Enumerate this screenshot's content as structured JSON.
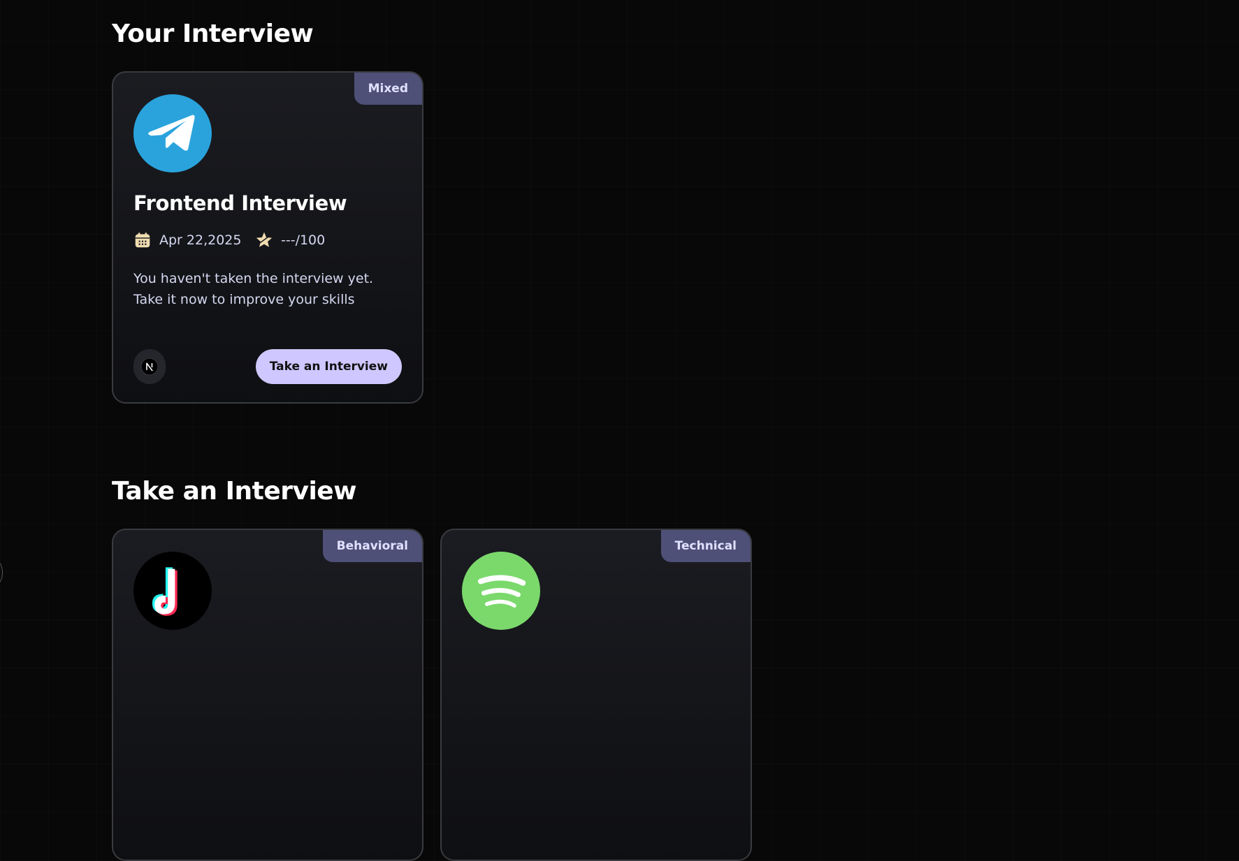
{
  "sections": {
    "your_interview_title": "Your Interview",
    "take_interview_title": "Take an Interview"
  },
  "your_interviews": [
    {
      "badge": "Mixed",
      "logo": "telegram-logo",
      "title": "Frontend Interview",
      "date": "Apr 22,2025",
      "score": "---/100",
      "description": "You haven't taken the interview yet. Take it now to improve your skills",
      "tech_icon": "nextjs-icon",
      "action_label": "Take an Interview"
    }
  ],
  "take_interviews": [
    {
      "badge": "Behavioral",
      "logo": "tiktok-logo"
    },
    {
      "badge": "Technical",
      "logo": "spotify-logo"
    }
  ],
  "colors": {
    "background": "#080808",
    "card_top": "#1b1c21",
    "card_bottom": "#0e0f12",
    "badge_bg": "#4e5078",
    "badge_text": "#dfe1ff",
    "button_bg": "#cfc7ff",
    "meta_text": "#d6d8f0",
    "telegram_blue": "#2aa3dc",
    "spotify_green": "#7bd96c",
    "calendar_icon": "#f0dcb0"
  }
}
